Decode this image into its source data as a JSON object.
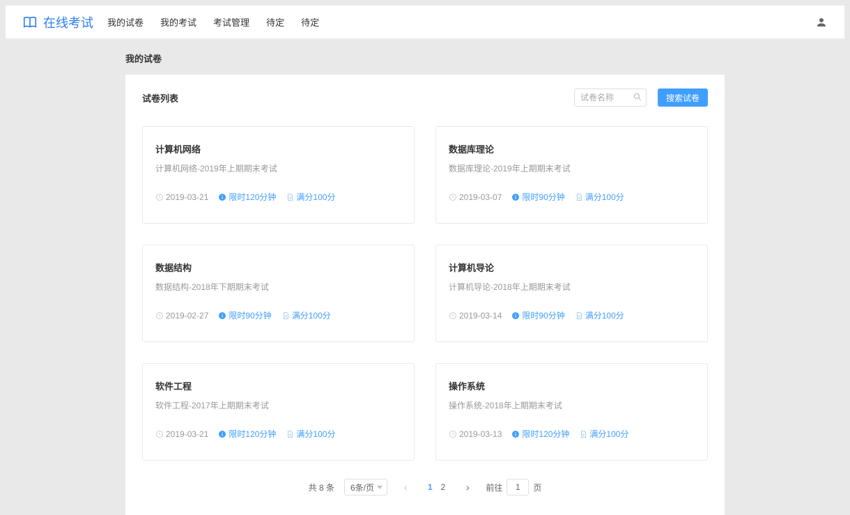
{
  "brand": "在线考试",
  "nav": [
    "我的试卷",
    "我的考试",
    "考试管理",
    "待定",
    "待定"
  ],
  "page_title": "我的试卷",
  "list_label": "试卷列表",
  "search": {
    "placeholder": "试卷名称",
    "button": "搜索试卷"
  },
  "cards": [
    {
      "title": "计算机网络",
      "desc": "计算机网络-2019年上期期末考试",
      "date": "2019-03-21",
      "limit": "限时120分钟",
      "score": "满分100分"
    },
    {
      "title": "数据库理论",
      "desc": "数据库理论-2019年上期期末考试",
      "date": "2019-03-07",
      "limit": "限时90分钟",
      "score": "满分100分"
    },
    {
      "title": "数据结构",
      "desc": "数据结构-2018年下期期末考试",
      "date": "2019-02-27",
      "limit": "限时90分钟",
      "score": "满分100分"
    },
    {
      "title": "计算机导论",
      "desc": "计算机导论-2018年上期期末考试",
      "date": "2019-03-14",
      "limit": "限时90分钟",
      "score": "满分100分"
    },
    {
      "title": "软件工程",
      "desc": "软件工程-2017年上期期末考试",
      "date": "2019-03-21",
      "limit": "限时120分钟",
      "score": "满分100分"
    },
    {
      "title": "操作系统",
      "desc": "操作系统-2018年上期期末考试",
      "date": "2019-03-13",
      "limit": "限时120分钟",
      "score": "满分100分"
    }
  ],
  "pagination": {
    "total_text": "共 8 条",
    "page_size": "6条/页",
    "pages": [
      "1",
      "2"
    ],
    "active": "1",
    "goto_prefix": "前往",
    "goto_suffix": "页",
    "goto_value": "1"
  }
}
